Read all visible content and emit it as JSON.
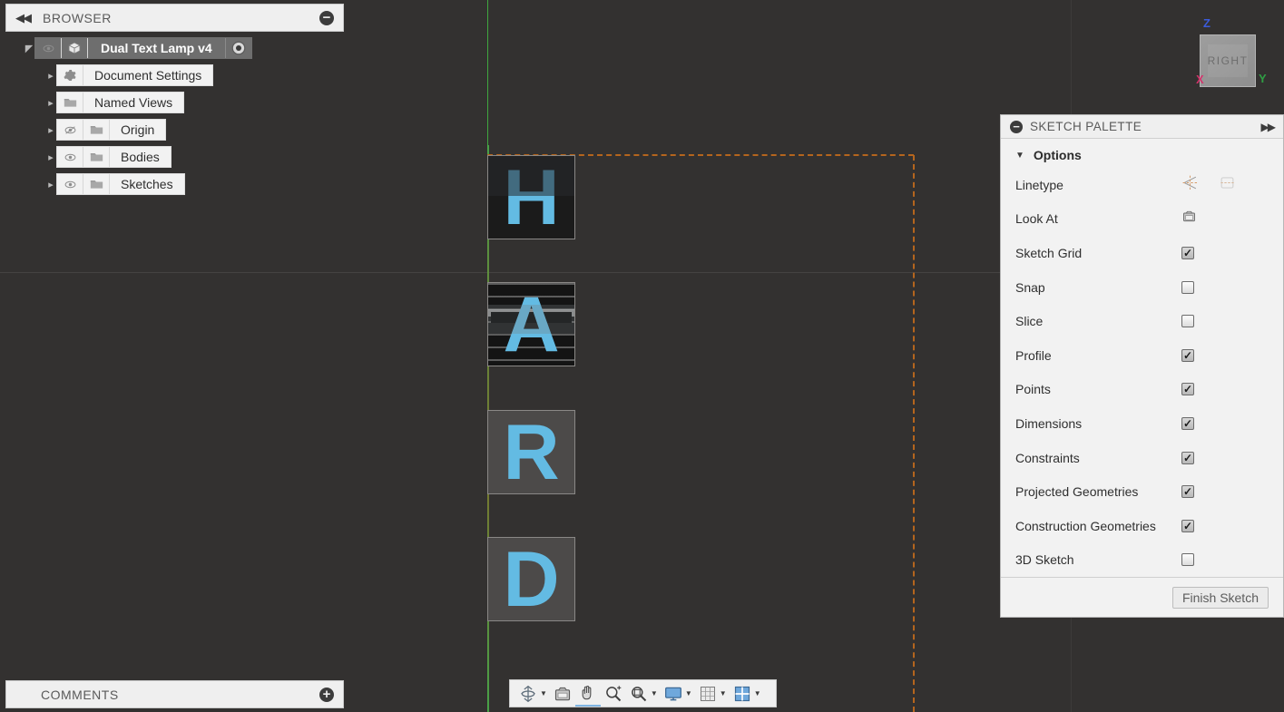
{
  "app": {
    "background_color": "#333130",
    "accent_blue": "#63bbe3",
    "construction_orange": "#b5651d",
    "axis_green": "#3fa63f"
  },
  "browser": {
    "title": "BROWSER",
    "collapse_icon": "double-left-arrows",
    "minimize_icon": "minus-circle",
    "tree": [
      {
        "label": "Dual Text Lamp v4",
        "icon": "component-cube-icon",
        "visibility": "visible",
        "selected": true,
        "has_expander": true,
        "expander_state": "expanded",
        "trailing_icon": "activate-radio-icon",
        "indent": 0
      },
      {
        "label": "Document Settings",
        "icon": "gear-icon",
        "visibility": "none",
        "selected": false,
        "has_expander": true,
        "expander_state": "collapsed",
        "indent": 1
      },
      {
        "label": "Named Views",
        "icon": "folder-icon",
        "visibility": "none",
        "selected": false,
        "has_expander": true,
        "expander_state": "collapsed",
        "indent": 1
      },
      {
        "label": "Origin",
        "icon": "folder-icon",
        "visibility": "hidden",
        "selected": false,
        "has_expander": true,
        "expander_state": "collapsed",
        "indent": 1
      },
      {
        "label": "Bodies",
        "icon": "folder-icon",
        "visibility": "visible",
        "selected": false,
        "has_expander": true,
        "expander_state": "collapsed",
        "indent": 1
      },
      {
        "label": "Sketches",
        "icon": "folder-icon",
        "visibility": "visible",
        "selected": false,
        "has_expander": true,
        "expander_state": "collapsed",
        "indent": 1
      }
    ]
  },
  "comments": {
    "title": "COMMENTS",
    "add_icon": "plus-circle-icon"
  },
  "sketch_palette": {
    "title": "SKETCH PALETTE",
    "minimize_icon": "minus-circle",
    "expand_icon": "double-right-arrows",
    "section_label": "Options",
    "section_expanded": true,
    "rows": [
      {
        "label": "Linetype",
        "control": "icons",
        "icons": [
          "construction-line-icon",
          "centerline-icon"
        ]
      },
      {
        "label": "Look At",
        "control": "icon",
        "icons": [
          "look-at-icon"
        ]
      },
      {
        "label": "Sketch Grid",
        "control": "checkbox",
        "checked": true
      },
      {
        "label": "Snap",
        "control": "checkbox",
        "checked": false
      },
      {
        "label": "Slice",
        "control": "checkbox",
        "checked": false
      },
      {
        "label": "Profile",
        "control": "checkbox",
        "checked": true
      },
      {
        "label": "Points",
        "control": "checkbox",
        "checked": true
      },
      {
        "label": "Dimensions",
        "control": "checkbox",
        "checked": true
      },
      {
        "label": "Constraints",
        "control": "checkbox",
        "checked": true
      },
      {
        "label": "Projected Geometries",
        "control": "checkbox",
        "checked": true
      },
      {
        "label": "Construction Geometries",
        "control": "checkbox",
        "checked": true
      },
      {
        "label": "3D Sketch",
        "control": "checkbox",
        "checked": false
      }
    ],
    "finish_button": "Finish Sketch"
  },
  "viewcube": {
    "face_label": "RIGHT",
    "axes": [
      {
        "label": "Z",
        "color": "#3b5bdb"
      },
      {
        "label": "Y",
        "color": "#2f9e44"
      },
      {
        "label": "X",
        "color": "#d6336c"
      }
    ]
  },
  "canvas": {
    "letters": [
      {
        "char": "H",
        "style": "dark-overlay"
      },
      {
        "char": "A",
        "style": "banded"
      },
      {
        "char": "R",
        "style": "plain"
      },
      {
        "char": "D",
        "style": "plain"
      }
    ]
  },
  "navbar": {
    "items": [
      {
        "icon": "orbit-icon",
        "has_caret": true,
        "active": false
      },
      {
        "icon": "look-at-icon",
        "has_caret": false,
        "active": false
      },
      {
        "icon": "pan-hand-icon",
        "has_caret": false,
        "active": true
      },
      {
        "icon": "zoom-icon",
        "has_caret": false,
        "active": false
      },
      {
        "icon": "zoom-window-icon",
        "has_caret": true,
        "active": false
      },
      {
        "icon": "display-settings-icon",
        "has_caret": true,
        "active": false
      },
      {
        "icon": "grid-snaps-icon",
        "has_caret": true,
        "active": false
      },
      {
        "icon": "viewport-layout-icon",
        "has_caret": true,
        "active": false
      }
    ]
  }
}
